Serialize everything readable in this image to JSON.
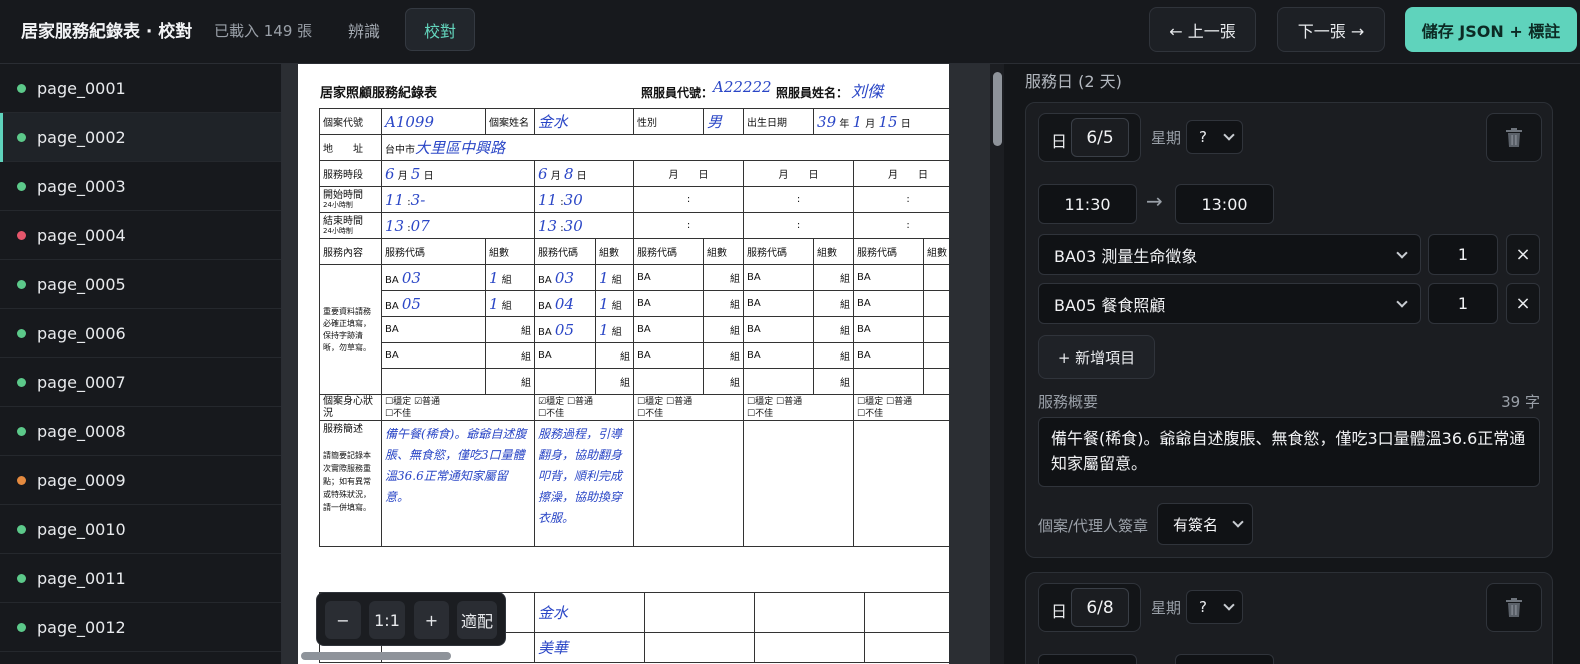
{
  "header": {
    "app_title": "居家服務紀錄表 · 校對",
    "loaded_count": "已載入 149 張",
    "tabs": [
      {
        "label": "辨識"
      },
      {
        "label": "校對"
      }
    ],
    "prev_label": "← 上一張",
    "next_label": "下一張 →",
    "save_label": "儲存 JSON + 標註"
  },
  "sidebar": {
    "pages": [
      {
        "name": "page_0001",
        "status": "green"
      },
      {
        "name": "page_0002",
        "status": "green"
      },
      {
        "name": "page_0003",
        "status": "green"
      },
      {
        "name": "page_0004",
        "status": "red"
      },
      {
        "name": "page_0005",
        "status": "green"
      },
      {
        "name": "page_0006",
        "status": "green"
      },
      {
        "name": "page_0007",
        "status": "green"
      },
      {
        "name": "page_0008",
        "status": "green"
      },
      {
        "name": "page_0009",
        "status": "orange"
      },
      {
        "name": "page_0010",
        "status": "green"
      },
      {
        "name": "page_0011",
        "status": "green"
      },
      {
        "name": "page_0012",
        "status": "green"
      }
    ]
  },
  "status_colors": {
    "green": "#5cc98a",
    "red": "#e5566b",
    "orange": "#e48a3f",
    "accent": "#5fd3bc"
  },
  "document": {
    "title": "居家照顧服務紀錄表",
    "caregiver_code_label": "照服員代號：",
    "caregiver_code": "A22222",
    "caregiver_name_label": "照服員姓名：",
    "caregiver_name": "刘傑",
    "case_code_label": "個案代號",
    "case_code": "A1099",
    "case_name_label": "個案姓名",
    "case_name": "金水",
    "gender_label": "性別",
    "gender": "男",
    "birth_label": "出生日期",
    "birth_year": "39",
    "birth_month": "1",
    "birth_day": "15",
    "year_unit": "年",
    "month_unit": "月",
    "day_unit": "日",
    "address_label": "地　　址",
    "address_city": "台中市",
    "address_rest": "大里區中興路",
    "period_label": "服務時段",
    "start_label": "開始時間",
    "end_label": "結束時間",
    "hour_note": "24小時制",
    "content_label": "服務內容",
    "code_header": "服務代碼",
    "count_header": "組數",
    "prefix": "BA",
    "group_unit": "組",
    "content_note": "重要資料請務必確正填寫，保持字跡清晰，勿草寫。",
    "condition_label": "個案身心狀況",
    "opt_stable": "穩定",
    "opt_normal": "普通",
    "opt_poor": "不佳",
    "brief_label": "服務簡述",
    "brief_note": "請簡要記錄本次實際服務重點；如有異常或特殊狀況，請一併填寫。",
    "colon": ":",
    "col1": {
      "month": "6",
      "day": "5",
      "start_h": "11",
      "start_m": "3-",
      "end_h": "13",
      "end_m": "07",
      "codes": [
        "03",
        "05"
      ],
      "counts": [
        "1",
        "1"
      ],
      "brief": "備午餐(稀食)。爺爺自述腹脹、無食慾，僅吃3口量體溫36.6正常通知家屬留意。"
    },
    "col2": {
      "month": "6",
      "day": "8",
      "start_h": "11",
      "start_m": "30",
      "end_h": "13",
      "end_m": "30",
      "codes": [
        "03",
        "04",
        "05"
      ],
      "counts": [
        "1",
        "1",
        "1"
      ],
      "brief": "服務過程，引導翻身，協助翻身叩背，順利完成擦澡，協助換穿衣服。"
    },
    "sign_name": "金水",
    "sign_name2": "美華"
  },
  "zoom": {
    "out_label": "−",
    "reset_label": "1:1",
    "in_label": "+",
    "fit_label": "適配"
  },
  "panel": {
    "days_header": "服務日 (2 天)",
    "day_label": "日",
    "weekday_label": "星期",
    "days": [
      {
        "date": "6/5",
        "weekday": "?",
        "start_time": "11:30",
        "end_time": "13:00",
        "items": [
          {
            "code": "BA03 測量生命徵象",
            "qty": "1"
          },
          {
            "code": "BA05 餐食照顧",
            "qty": "1"
          }
        ],
        "add_item_label": "+ 新增項目",
        "summary_label": "服務概要",
        "char_count": "39 字",
        "summary": "備午餐(稀食)。爺爺自述腹脹、無食慾，僅吃3口量體溫36.6正常通知家屬留意。",
        "signature_label": "個案/代理人簽章",
        "signature": "有簽名"
      },
      {
        "date": "6/8",
        "weekday": "?"
      }
    ],
    "remove_label": "×",
    "time_arrow": "→"
  }
}
